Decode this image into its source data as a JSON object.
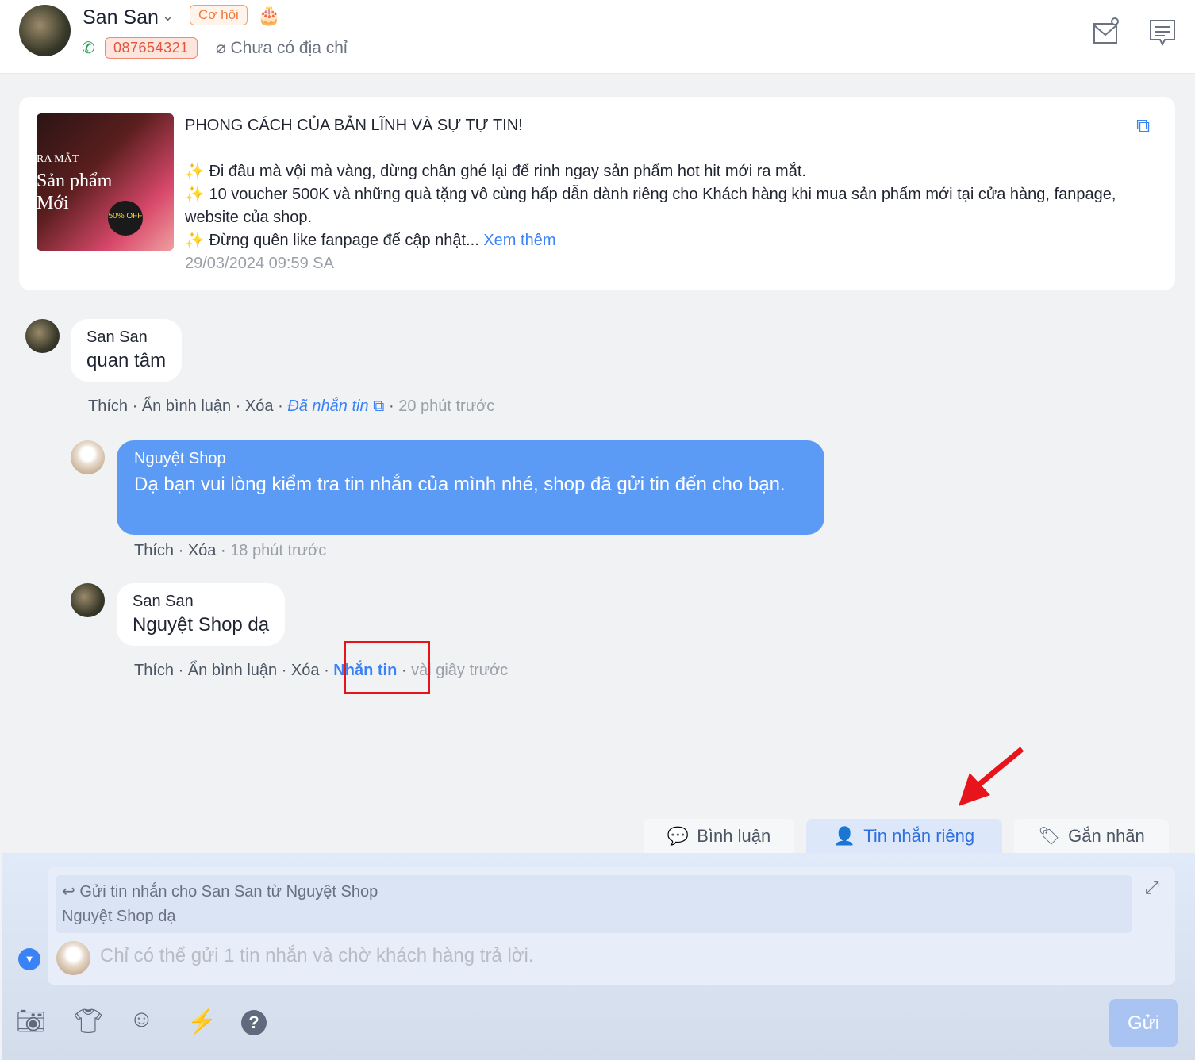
{
  "header": {
    "customer_name": "San San",
    "status_badge": "Cơ hội",
    "phone": "087654321",
    "address": "Chưa có địa chỉ"
  },
  "post": {
    "thumbnail_text": [
      "RA MẮT",
      "Sản phẩm",
      "Mới",
      "50% OFF"
    ],
    "title": "PHONG CÁCH CỦA BẢN LĨNH VÀ SỰ TỰ TIN!",
    "lines": [
      "Đi đâu mà vội mà vàng, dừng chân ghé lại để rinh ngay sản phẩm hot hit mới ra mắt.",
      "10 voucher 500K và những quà tặng vô cùng hấp dẫn dành riêng cho Khách hàng khi mua sản phẩm mới tại cửa hàng, fanpage, website của shop.",
      "Đừng quên like fanpage để cập nhật..."
    ],
    "see_more": "Xem thêm",
    "timestamp": "29/03/2024 09:59 SA"
  },
  "comments": [
    {
      "author": "San San",
      "text": "quan tâm",
      "like": "Thích",
      "hide": "Ẩn bình luận",
      "delete": "Xóa",
      "messaged": "Đã nhắn tin",
      "time": "20 phút trước"
    },
    {
      "author": "Nguyệt Shop",
      "text": "Dạ bạn vui lòng kiểm tra tin nhắn của mình nhé, shop đã gửi tin đến cho bạn.",
      "like": "Thích",
      "delete": "Xóa",
      "time": "18 phút trước"
    },
    {
      "author": "San San",
      "text": "Nguyệt Shop dạ",
      "like": "Thích",
      "hide": "Ẩn bình luận",
      "delete": "Xóa",
      "message": "Nhắn tin",
      "time": "vài giây trước"
    }
  ],
  "tabs": {
    "comment": "Bình luận",
    "private_message": "Tin nhắn riêng",
    "tag": "Gắn nhãn"
  },
  "composer": {
    "reply_header": "Gửi tin nhắn cho San San từ Nguyệt Shop",
    "quoted": "Nguyệt Shop dạ",
    "placeholder": "Chỉ có thể gửi 1 tin nhắn và chờ khách hàng trả lời.",
    "send": "Gửi"
  },
  "colors": {
    "accent": "#3b82f6",
    "bubble_shop": "#5b9af5",
    "highlight": "#e8141c"
  }
}
